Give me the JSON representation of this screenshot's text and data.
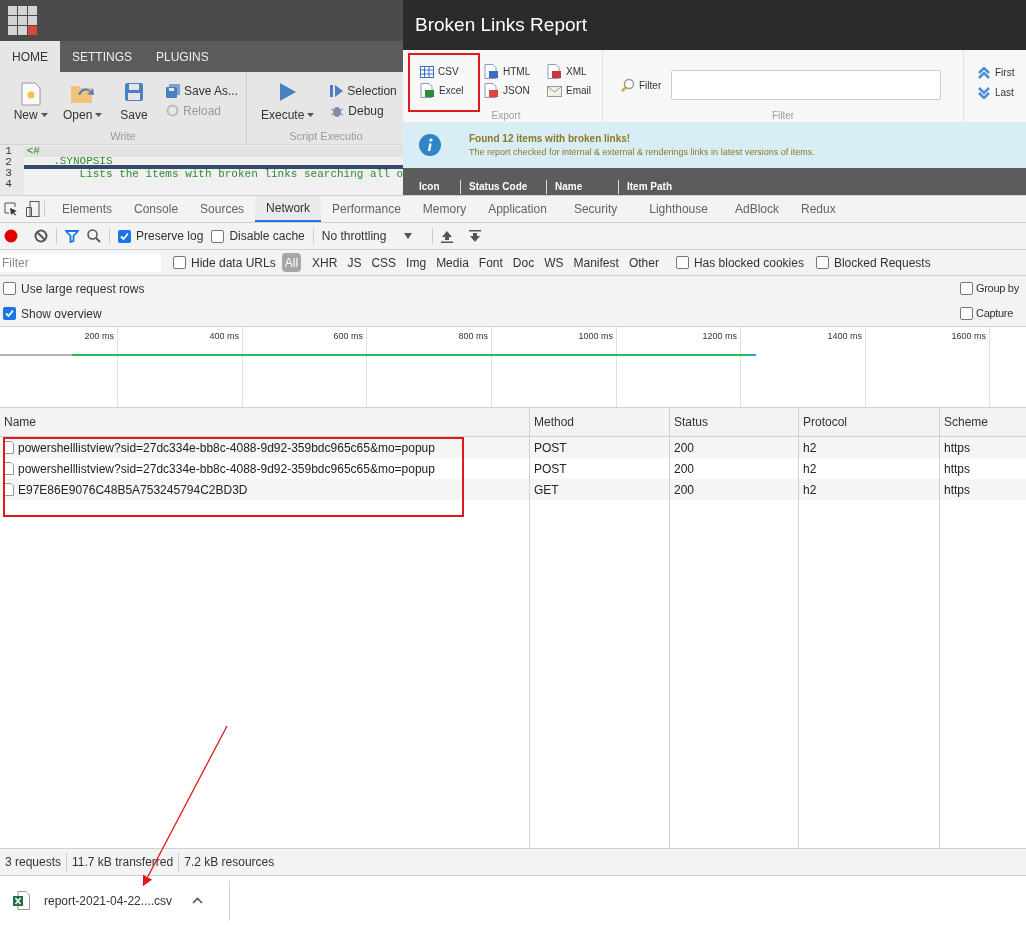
{
  "script_editor": {
    "tabs": [
      {
        "label": "HOME",
        "selected": true
      },
      {
        "label": "SETTINGS",
        "selected": false
      },
      {
        "label": "PLUGINS",
        "selected": false
      }
    ],
    "ribbon_groups": [
      {
        "label": "Write",
        "buttons": [
          {
            "label": "New",
            "kind": "new",
            "dropdown": true,
            "disabled": false
          },
          {
            "label": "Open",
            "kind": "open",
            "dropdown": true,
            "disabled": false
          },
          {
            "label": "Save",
            "kind": "save",
            "dropdown": false,
            "disabled": false
          },
          {
            "label": "Save As...",
            "kind": "saveas",
            "dropdown": false,
            "disabled": false
          },
          {
            "label": "Reload",
            "kind": "reload",
            "dropdown": false,
            "disabled": true
          }
        ]
      },
      {
        "label": "Script Executio",
        "buttons": [
          {
            "label": "Execute",
            "kind": "execute",
            "dropdown": true,
            "disabled": false
          },
          {
            "label": "Selection",
            "kind": "selection",
            "dropdown": false,
            "disabled": false
          },
          {
            "label": "Debug",
            "kind": "debug",
            "dropdown": false,
            "disabled": false
          }
        ]
      }
    ],
    "editor_lines": [
      {
        "number": "1",
        "text": "<#"
      },
      {
        "number": "2",
        "text": "    .SYNOPSIS"
      },
      {
        "number": "3",
        "text": "        Lists the items with broken links searching all o"
      },
      {
        "number": "4"
      }
    ]
  },
  "report_dialog": {
    "title": "Broken Links Report",
    "export_buttons": [
      {
        "label": "CSV",
        "kind": "csv"
      },
      {
        "label": "HTML",
        "kind": "html"
      },
      {
        "label": "XML",
        "kind": "xml"
      },
      {
        "label": "Excel",
        "kind": "excel"
      },
      {
        "label": "JSON",
        "kind": "json"
      },
      {
        "label": "Email",
        "kind": "email"
      }
    ],
    "export_group": "Export",
    "filter_label": "Filter",
    "filter_group": "Filter",
    "nav_buttons": [
      {
        "label": "First",
        "kind": "first"
      },
      {
        "label": "Last",
        "kind": "last"
      }
    ],
    "message": {
      "title": "Found 12 items with broken links!",
      "text": "The report checked for internal & external & renderings links in latest versions of items."
    },
    "columns": [
      "Icon",
      "Status Code",
      "Name",
      "Item Path"
    ]
  },
  "devtools": {
    "tabs": [
      {
        "label": "Elements",
        "selected": false
      },
      {
        "label": "Console",
        "selected": false
      },
      {
        "label": "Sources",
        "selected": false
      },
      {
        "label": "Network",
        "selected": true
      },
      {
        "label": "Performance",
        "selected": false
      },
      {
        "label": "Memory",
        "selected": false
      },
      {
        "label": "Application",
        "selected": false
      },
      {
        "label": "Security",
        "selected": false
      },
      {
        "label": "Lighthouse",
        "selected": false
      },
      {
        "label": "AdBlock",
        "selected": false
      },
      {
        "label": "Redux",
        "selected": false
      }
    ],
    "recording": true,
    "preserve_log": {
      "label": "Preserve log",
      "checked": true
    },
    "disable_cache": {
      "label": "Disable cache",
      "checked": false
    },
    "throttling": "No throttling",
    "filter": {
      "placeholder": "Filter"
    },
    "hide_data_urls": {
      "label": "Hide data URLs",
      "checked": false
    },
    "types": [
      {
        "label": "All",
        "selected": true
      },
      {
        "label": "XHR",
        "selected": false
      },
      {
        "label": "JS",
        "selected": false
      },
      {
        "label": "CSS",
        "selected": false
      },
      {
        "label": "Img",
        "selected": false
      },
      {
        "label": "Media",
        "selected": false
      },
      {
        "label": "Font",
        "selected": false
      },
      {
        "label": "Doc",
        "selected": false
      },
      {
        "label": "WS",
        "selected": false
      },
      {
        "label": "Manifest",
        "selected": false
      },
      {
        "label": "Other",
        "selected": false
      }
    ],
    "blocked_filters": [
      {
        "label": "Has blocked cookies",
        "checked": false
      },
      {
        "label": "Blocked Requests",
        "checked": false
      }
    ],
    "settings_left": [
      {
        "label": "Use large request rows",
        "checked": false
      },
      {
        "label": "Show overview",
        "checked": true
      }
    ],
    "settings_right": [
      {
        "label": "Group by",
        "checked": false
      },
      {
        "label": "Capture",
        "checked": false
      }
    ],
    "timeline_ticks": [
      "200 ms",
      "400 ms",
      "600 ms",
      "800 ms",
      "1000 ms",
      "1200 ms",
      "1400 ms",
      "1600 ms"
    ],
    "columns": [
      "Name",
      "Method",
      "Status",
      "Protocol",
      "Scheme"
    ],
    "requests": [
      {
        "name": "powershelllistview?sid=27dc334e-bb8c-4088-9d92-359bdc965c65&mo=popup",
        "method": "POST",
        "status": "200",
        "protocol": "h2",
        "scheme": "https"
      },
      {
        "name": "powershelllistview?sid=27dc334e-bb8c-4088-9d92-359bdc965c65&mo=popup",
        "method": "POST",
        "status": "200",
        "protocol": "h2",
        "scheme": "https"
      },
      {
        "name": "E97E86E9076C48B5A753245794C2BD3D",
        "method": "GET",
        "status": "200",
        "protocol": "h2",
        "scheme": "https"
      }
    ],
    "summary": [
      "3 requests",
      "11.7 kB transferred",
      "7.2 kB resources"
    ]
  },
  "download": {
    "file": "report-2021-04-22....csv"
  }
}
